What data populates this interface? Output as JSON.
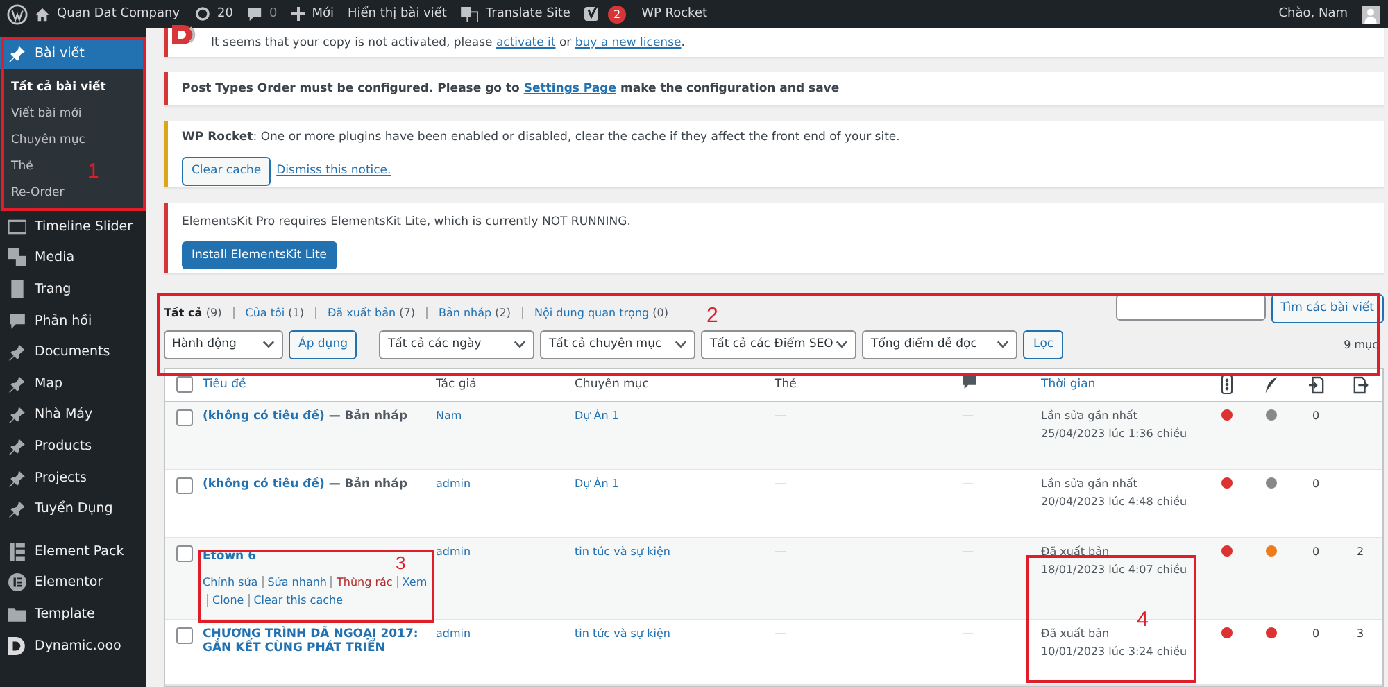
{
  "admin_bar": {
    "site": "Quan Dat Company",
    "updates": "20",
    "comments": "0",
    "new": "Mới",
    "view": "Hiển thị bài viết",
    "translate": "Translate Site",
    "yoast_badge": "2",
    "rocket": "WP Rocket",
    "greeting": "Chào, Nam"
  },
  "sidebar": {
    "current": {
      "label": "Bài viết",
      "selected": true,
      "submenu": [
        {
          "label": "Tất cả bài viết",
          "selected": true
        },
        {
          "label": "Viết bài mới",
          "selected": false
        },
        {
          "label": "Chuyên mục",
          "selected": false
        },
        {
          "label": "Thẻ",
          "selected": false
        },
        {
          "label": "Re-Order",
          "selected": false
        }
      ]
    },
    "items": [
      {
        "label": "Timeline Slider",
        "kind": "slider",
        "selected": false
      },
      {
        "label": "Media",
        "kind": "media",
        "selected": false
      },
      {
        "label": "Trang",
        "kind": "page",
        "selected": false
      },
      {
        "label": "Phản hồi",
        "kind": "comment",
        "selected": false
      },
      {
        "label": "Documents",
        "kind": "pin",
        "selected": false
      },
      {
        "label": "Map",
        "kind": "pin",
        "selected": false
      },
      {
        "label": "Nhà Máy",
        "kind": "pin",
        "selected": false
      },
      {
        "label": "Products",
        "kind": "pin",
        "selected": false
      },
      {
        "label": "Projects",
        "kind": "pin",
        "selected": false
      },
      {
        "label": "Tuyển Dụng",
        "kind": "pin",
        "selected": false
      },
      {
        "label": "Element Pack",
        "kind": "pack",
        "selected": false
      },
      {
        "label": "Elementor",
        "kind": "elementor",
        "selected": false
      },
      {
        "label": "Template",
        "kind": "folder",
        "selected": false
      },
      {
        "label": "Dynamic.ooo",
        "kind": "dynamic",
        "selected": false
      }
    ]
  },
  "notices": [
    {
      "kind": "dynamic",
      "text": "It seems that your copy is not activated, please ",
      "link1": "activate it",
      "mid": " or ",
      "link2": "buy a new license",
      "end": "."
    },
    {
      "kind": "pto",
      "text": "Post Types Order must be configured. Please go to ",
      "link1": "Settings Page",
      "end": " make the configuration and save"
    },
    {
      "kind": "rocket",
      "text": "**WP Rocket**: One or more plugins have been enabled or disabled, clear the cache if they affect the front end of your site.",
      "button": "Clear cache",
      "link1": "Dismiss this notice."
    },
    {
      "kind": "ekit",
      "text": "ElementsKit Pro requires ElementsKit Lite, which is currently NOT RUNNING.",
      "button": "Install ElementsKit Lite"
    }
  ],
  "views": [
    {
      "label": "Tất cả",
      "count": "(9)",
      "selected": true
    },
    {
      "label": "Của tôi",
      "count": "(1)",
      "selected": false
    },
    {
      "label": "Đã xuất bản",
      "count": "(7)",
      "selected": false
    },
    {
      "label": "Bản nháp",
      "count": "(2)",
      "selected": false
    },
    {
      "label": "Nội dung quan trọng",
      "count": "(0)",
      "selected": false
    }
  ],
  "search": {
    "button": "Tìm các bài viết"
  },
  "filters": {
    "bulk": "Hành động",
    "apply": "Áp dụng",
    "dropdowns": [
      "Tất cả các ngày",
      "Tất cả chuyên mục",
      "Tất cả các Điểm SEO",
      "Tổng điểm dễ đọc"
    ],
    "filter": "Lọc",
    "count": "9 mục"
  },
  "table": {
    "select_all": {
      "checked": false
    },
    "columns": [
      "Tiêu đề",
      "Tác giả",
      "Chuyên mục",
      "Thẻ",
      "Thời gian"
    ],
    "rows": [
      {
        "checked": false,
        "title": "(không có tiêu đề)",
        "state": " — Bản nháp",
        "author": "Nam",
        "category": "Dự Án 1",
        "tags": "—",
        "comments": "—",
        "date_status": "Lần sửa gần nhất",
        "date": "25/04/2023 lúc 1:36 chiều",
        "scores": [
          {
            "color": "#dc3232"
          },
          {
            "color": "#888888"
          }
        ],
        "links_in": "0",
        "actions": []
      },
      {
        "checked": false,
        "title": "(không có tiêu đề)",
        "state": " — Bản nháp",
        "author": "admin",
        "category": "Dự Án 1",
        "tags": "—",
        "comments": "—",
        "date_status": "Lần sửa gần nhất",
        "date": "20/04/2023 lúc 4:48 chiều",
        "scores": [
          {
            "color": "#dc3232"
          },
          {
            "color": "#888888"
          }
        ],
        "links_in": "0",
        "actions": []
      },
      {
        "checked": false,
        "title": "Etown 6",
        "author": "admin",
        "category": "tin tức và sự kiện",
        "tags": "—",
        "comments": "—",
        "date_status": "Đã xuất bản",
        "date": "18/01/2023 lúc 4:07 chiều",
        "scores": [
          {
            "color": "#dc3232"
          },
          {
            "color": "#ee7c1b"
          }
        ],
        "links_in": "0",
        "links_out": "2",
        "actions": [
          {
            "label": "Chỉnh sửa",
            "kind": "link"
          },
          {
            "label": "Sửa nhanh",
            "kind": "link"
          },
          {
            "label": "Thùng rác",
            "kind": "trash"
          },
          {
            "label": "Xem",
            "kind": "link"
          },
          {
            "label": "Clone",
            "kind": "link"
          },
          {
            "label": "Clear this cache",
            "kind": "link"
          }
        ]
      },
      {
        "checked": false,
        "title": "CHƯƠNG TRÌNH DÃ NGOẠI 2017: GẮN KẾT CÙNG PHÁT TRIỂN",
        "author": "admin",
        "category": "tin tức và sự kiện",
        "tags": "—",
        "comments": "—",
        "date_status": "Đã xuất bản",
        "date": "10/01/2023 lúc 3:24 chiều",
        "scores": [
          {
            "color": "#dc3232"
          },
          {
            "color": "#dc3232"
          }
        ],
        "links_in": "0",
        "links_out": "3",
        "actions": []
      }
    ]
  },
  "annotations": [
    "1",
    "2",
    "3",
    "4"
  ]
}
